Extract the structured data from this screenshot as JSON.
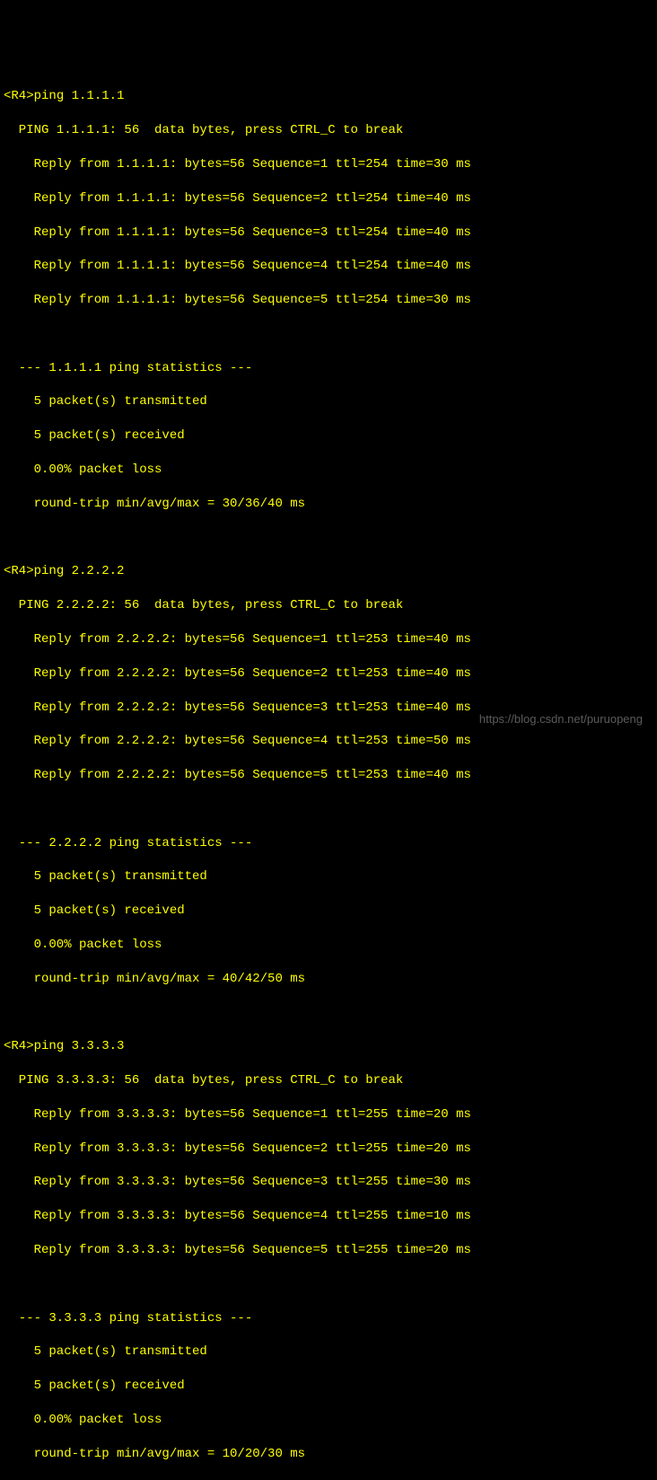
{
  "prompt": "<R4>",
  "watermark": "https://blog.csdn.net/puruopeng",
  "sessions": [
    {
      "target": "1.1.1.1",
      "command": "ping 1.1.1.1",
      "header": "PING 1.1.1.1: 56  data bytes, press CTRL_C to break",
      "replies": [
        "Reply from 1.1.1.1: bytes=56 Sequence=1 ttl=254 time=30 ms",
        "Reply from 1.1.1.1: bytes=56 Sequence=2 ttl=254 time=40 ms",
        "Reply from 1.1.1.1: bytes=56 Sequence=3 ttl=254 time=40 ms",
        "Reply from 1.1.1.1: bytes=56 Sequence=4 ttl=254 time=40 ms",
        "Reply from 1.1.1.1: bytes=56 Sequence=5 ttl=254 time=30 ms"
      ],
      "stats_header": "--- 1.1.1.1 ping statistics ---",
      "transmitted": "5 packet(s) transmitted",
      "received": "5 packet(s) received",
      "loss": "0.00% packet loss",
      "roundtrip": "round-trip min/avg/max = 30/36/40 ms"
    },
    {
      "target": "2.2.2.2",
      "command": "ping 2.2.2.2",
      "header": "PING 2.2.2.2: 56  data bytes, press CTRL_C to break",
      "replies": [
        "Reply from 2.2.2.2: bytes=56 Sequence=1 ttl=253 time=40 ms",
        "Reply from 2.2.2.2: bytes=56 Sequence=2 ttl=253 time=40 ms",
        "Reply from 2.2.2.2: bytes=56 Sequence=3 ttl=253 time=40 ms",
        "Reply from 2.2.2.2: bytes=56 Sequence=4 ttl=253 time=50 ms",
        "Reply from 2.2.2.2: bytes=56 Sequence=5 ttl=253 time=40 ms"
      ],
      "stats_header": "--- 2.2.2.2 ping statistics ---",
      "transmitted": "5 packet(s) transmitted",
      "received": "5 packet(s) received",
      "loss": "0.00% packet loss",
      "roundtrip": "round-trip min/avg/max = 40/42/50 ms"
    },
    {
      "target": "3.3.3.3",
      "command": "ping 3.3.3.3",
      "header": "PING 3.3.3.3: 56  data bytes, press CTRL_C to break",
      "replies": [
        "Reply from 3.3.3.3: bytes=56 Sequence=1 ttl=255 time=20 ms",
        "Reply from 3.3.3.3: bytes=56 Sequence=2 ttl=255 time=20 ms",
        "Reply from 3.3.3.3: bytes=56 Sequence=3 ttl=255 time=30 ms",
        "Reply from 3.3.3.3: bytes=56 Sequence=4 ttl=255 time=10 ms",
        "Reply from 3.3.3.3: bytes=56 Sequence=5 ttl=255 time=20 ms"
      ],
      "stats_header": "--- 3.3.3.3 ping statistics ---",
      "transmitted": "5 packet(s) transmitted",
      "received": "5 packet(s) received",
      "loss": "0.00% packet loss",
      "roundtrip": "round-trip min/avg/max = 10/20/30 ms"
    }
  ]
}
